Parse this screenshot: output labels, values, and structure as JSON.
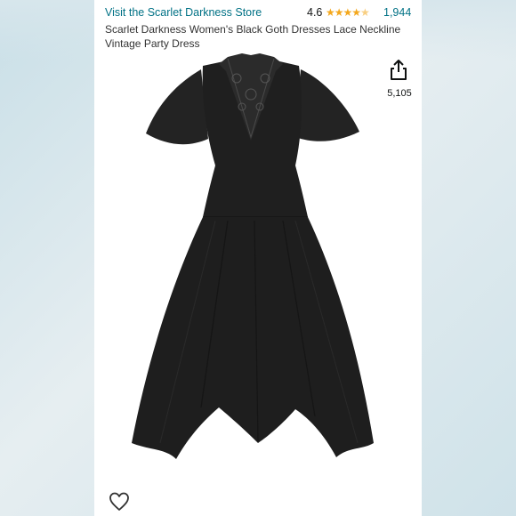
{
  "store": {
    "link_text": "Visit the Scarlet Darkness Store",
    "rating": "4.6",
    "stars": "★★★★",
    "review_count": "1,944"
  },
  "product": {
    "title": "Scarlet Darkness Women's Black Goth Dresses Lace Neckline Vintage Party Dress",
    "share_count": "5,105"
  },
  "icons": {
    "share": "share-icon",
    "wishlist": "heart-icon"
  },
  "colors": {
    "link": "#007185",
    "star": "#f4a81d",
    "text": "#0f1111",
    "dress": "#1e1e1e"
  }
}
